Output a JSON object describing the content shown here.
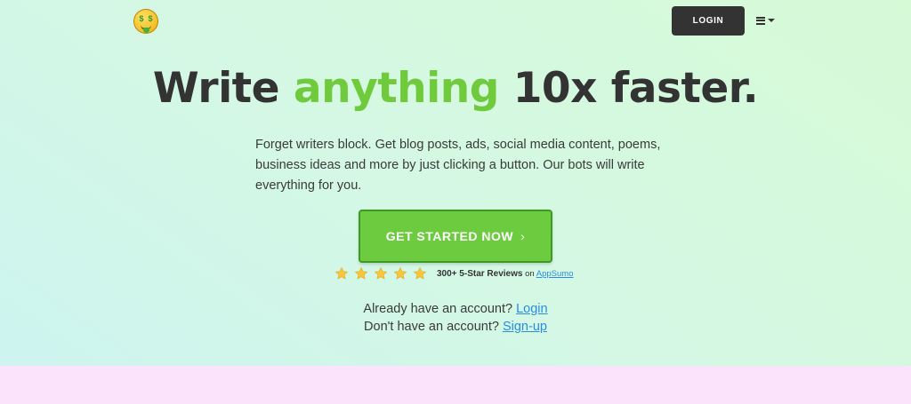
{
  "header": {
    "logo_icon": "money-mouth-face-icon",
    "login_label": "LOGIN",
    "menu_icon": "hamburger-menu-icon"
  },
  "hero": {
    "headline": {
      "before": "Write ",
      "accent": "anything",
      "after": " 10x faster."
    },
    "accent_color": "#6fcb3c",
    "description": "Forget writers block. Get blog posts, ads, social media content, poems, business ideas and more by just clicking a button. Our bots will write everything for you.",
    "cta_label": "GET STARTED NOW",
    "cta_chevron": "›",
    "cta_color": "#6ccb3e"
  },
  "reviews": {
    "star_count": 5,
    "star_icon": "star-icon",
    "count_text": "300+ 5-Star Reviews",
    "on_text": " on ",
    "source_link": "AppSumo"
  },
  "account": {
    "have_account_text": "Already have an account? ",
    "login_link": "Login",
    "no_account_text": "Don't have an account? ",
    "signup_link": "Sign-up"
  }
}
